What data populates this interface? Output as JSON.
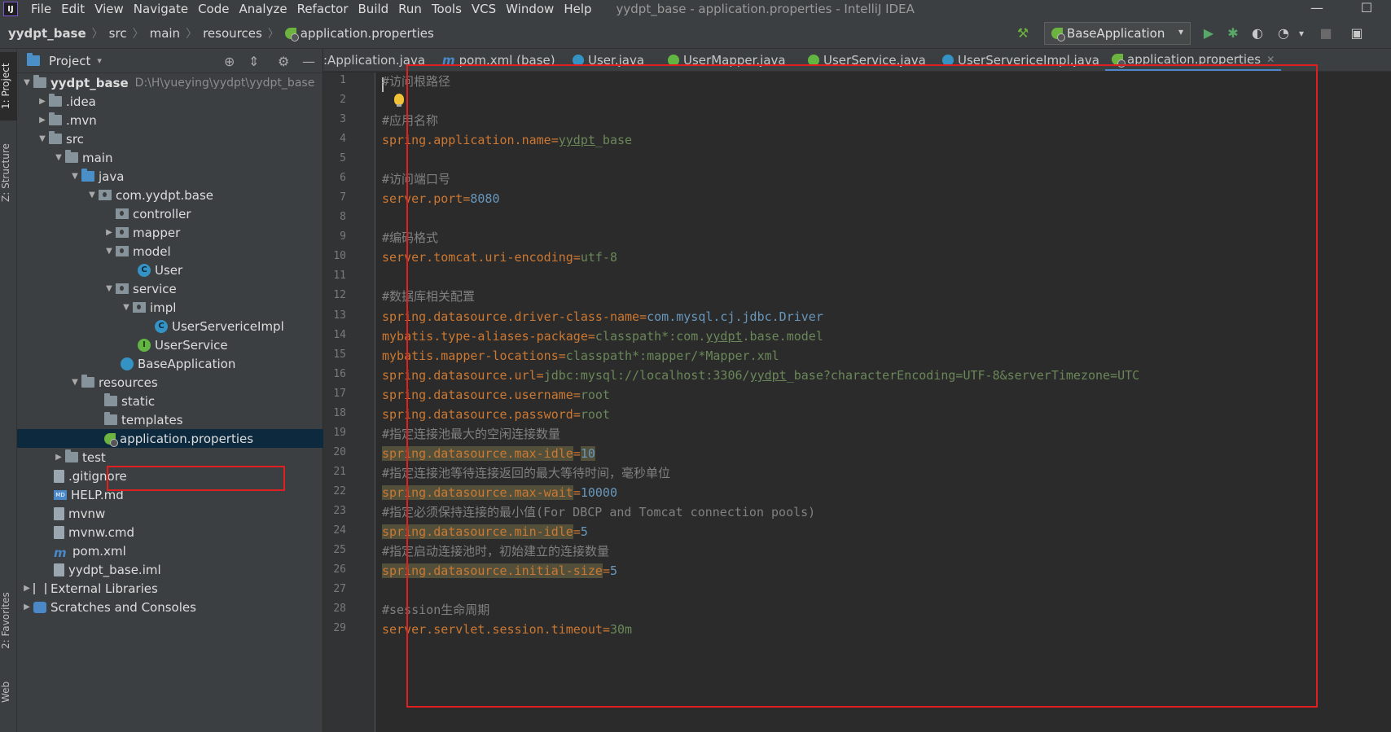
{
  "menubar": {
    "app_icon_label": "IJ",
    "items": [
      {
        "label": "File"
      },
      {
        "label": "Edit"
      },
      {
        "label": "View"
      },
      {
        "label": "Navigate"
      },
      {
        "label": "Code"
      },
      {
        "label": "Analyze"
      },
      {
        "label": "Refactor"
      },
      {
        "label": "Build"
      },
      {
        "label": "Run"
      },
      {
        "label": "Tools"
      },
      {
        "label": "VCS"
      },
      {
        "label": "Window"
      },
      {
        "label": "Help"
      }
    ],
    "window_title": "yydpt_base - application.properties - IntelliJ IDEA",
    "minimize_glyph": "—",
    "maximize_glyph": "☐"
  },
  "breadcrumb": {
    "items": [
      "yydpt_base",
      "src",
      "main",
      "resources",
      "application.properties"
    ],
    "separator": "〉"
  },
  "toolbar": {
    "run_config": "BaseApplication",
    "caret_glyph": "▾",
    "icons": {
      "build": "hammer-icon",
      "run": "run-icon",
      "debug": "debug-icon",
      "coverage": "coverage-icon",
      "profile": "profile-icon",
      "stop": "stop-icon",
      "structure": "project-structure-icon"
    },
    "glyphs": {
      "build": "⚒",
      "run": "▶",
      "debug": "✱",
      "coverage": "◐",
      "profile": "◔",
      "dropdown": "▾",
      "stop": "■",
      "structure": "▣"
    }
  },
  "left_strip": {
    "project_tab": "1: Project",
    "structure_tab": "Z: Structure",
    "favorites_tab": "2: Favorites",
    "web_tab": "Web"
  },
  "project_panel": {
    "title": "Project",
    "title_caret": "▾",
    "header_glyphs": {
      "locate": "⊕",
      "collapse": "⇕",
      "settings": "⚙",
      "hide": "—"
    },
    "tree": [
      {
        "label": "yydpt_base",
        "path": "D:\\H\\yueying\\yydpt\\yydpt_base",
        "arrow": "▼"
      },
      {
        "label": ".idea",
        "arrow": "▶"
      },
      {
        "label": ".mvn",
        "arrow": "▶"
      },
      {
        "label": "src",
        "arrow": "▼"
      },
      {
        "label": "main",
        "arrow": "▼"
      },
      {
        "label": "java",
        "arrow": "▼"
      },
      {
        "label": "com.yydpt.base",
        "arrow": "▼"
      },
      {
        "label": "controller"
      },
      {
        "label": "mapper",
        "arrow": "▶"
      },
      {
        "label": "model",
        "arrow": "▼"
      },
      {
        "label": "User"
      },
      {
        "label": "service",
        "arrow": "▼"
      },
      {
        "label": "impl",
        "arrow": "▼"
      },
      {
        "label": "UserServericeImpl"
      },
      {
        "label": "UserService"
      },
      {
        "label": "BaseApplication"
      },
      {
        "label": "resources",
        "arrow": "▼"
      },
      {
        "label": "static"
      },
      {
        "label": "templates"
      },
      {
        "label": "application.properties"
      },
      {
        "label": "test",
        "arrow": "▶"
      },
      {
        "label": ".gitignore"
      },
      {
        "label": "HELP.md"
      },
      {
        "label": "mvnw"
      },
      {
        "label": "mvnw.cmd"
      },
      {
        "label": "pom.xml"
      },
      {
        "label": "yydpt_base.iml"
      },
      {
        "label": "External Libraries",
        "arrow": "▶"
      },
      {
        "label": "Scratches and Consoles",
        "arrow": "▶"
      }
    ],
    "icon_glyphs": {
      "class": "C",
      "interface": "I",
      "md": "MD",
      "mvn": "m"
    }
  },
  "tabs": [
    {
      "label": ":Application.java",
      "icon": "spring-boot-class-icon"
    },
    {
      "label": "pom.xml (base)",
      "icon": "maven-icon"
    },
    {
      "label": "User.java",
      "icon": "class-icon"
    },
    {
      "label": "UserMapper.java",
      "icon": "interface-icon"
    },
    {
      "label": "UserService.java",
      "icon": "interface-icon"
    },
    {
      "label": "UserServericeImpl.java",
      "icon": "class-icon"
    },
    {
      "label": "application.properties",
      "icon": "spring-properties-icon",
      "active": true
    }
  ],
  "tab_glyphs": {
    "close": "✕",
    "maven": "m"
  },
  "editor": {
    "line_numbers": [
      "1",
      "2",
      "3",
      "4",
      "5",
      "6",
      "7",
      "8",
      "9",
      "10",
      "11",
      "12",
      "13",
      "14",
      "15",
      "16",
      "17",
      "18",
      "19",
      "20",
      "21",
      "22",
      "23",
      "24",
      "25",
      "26",
      "27",
      "28",
      "29"
    ],
    "lines": [
      {
        "comment": "#访问根路径"
      },
      {},
      {
        "comment": "#应用名称"
      },
      {
        "key": "spring.application.name",
        "value_pre": "",
        "value_u": "yydpt",
        "value_post": "_base"
      },
      {},
      {
        "comment": "#访问端口号"
      },
      {
        "key": "server.port",
        "value": "8080"
      },
      {},
      {
        "comment": "#编码格式"
      },
      {
        "key": "server.tomcat.uri-encoding",
        "value": "utf-8"
      },
      {},
      {
        "comment": "#数据库相关配置"
      },
      {
        "key": "spring.datasource.driver-class-name",
        "value": "com.mysql.cj.jdbc.Driver"
      },
      {
        "key": "mybatis.type-aliases-package",
        "value_pre": "classpath*:com.",
        "value_u": "yydpt",
        "value_post": ".base.model"
      },
      {
        "key": "mybatis.mapper-locations",
        "value": "classpath*:mapper/*Mapper.xml"
      },
      {
        "key": "spring.datasource.url",
        "value_pre": "jdbc:mysql://localhost:3306/",
        "value_u": "yydpt",
        "value_post": "_base?characterEncoding=UTF-8&serverTimezone=UTC"
      },
      {
        "key": "spring.datasource.username",
        "value": "root"
      },
      {
        "key": "spring.datasource.password",
        "value": "root"
      },
      {
        "comment": "#指定连接池最大的空闲连接数量"
      },
      {
        "key": "spring.datasource.max-idle",
        "value": "10",
        "highlight": true
      },
      {
        "comment": "#指定连接池等待连接返回的最大等待时间，毫秒单位"
      },
      {
        "key": "spring.datasource.max-wait",
        "value": "10000",
        "highlight": true
      },
      {
        "comment": "#指定必须保持连接的最小值(For DBCP and Tomcat connection pools)"
      },
      {
        "key": "spring.datasource.min-idle",
        "value": "5",
        "highlight": true
      },
      {
        "comment": "#指定启动连接池时，初始建立的连接数量"
      },
      {
        "key": "spring.datasource.initial-size",
        "value": "5",
        "highlight": true
      },
      {},
      {
        "comment": "#session生命周期"
      },
      {
        "key": "server.servlet.session.timeout",
        "value": "30m"
      }
    ]
  },
  "colors": {
    "key": "#cc7832",
    "value": "#6a8759",
    "number": "#6897bb",
    "comment": "#808080",
    "annotation_box": "#e02020",
    "selection": "#0d293e"
  }
}
